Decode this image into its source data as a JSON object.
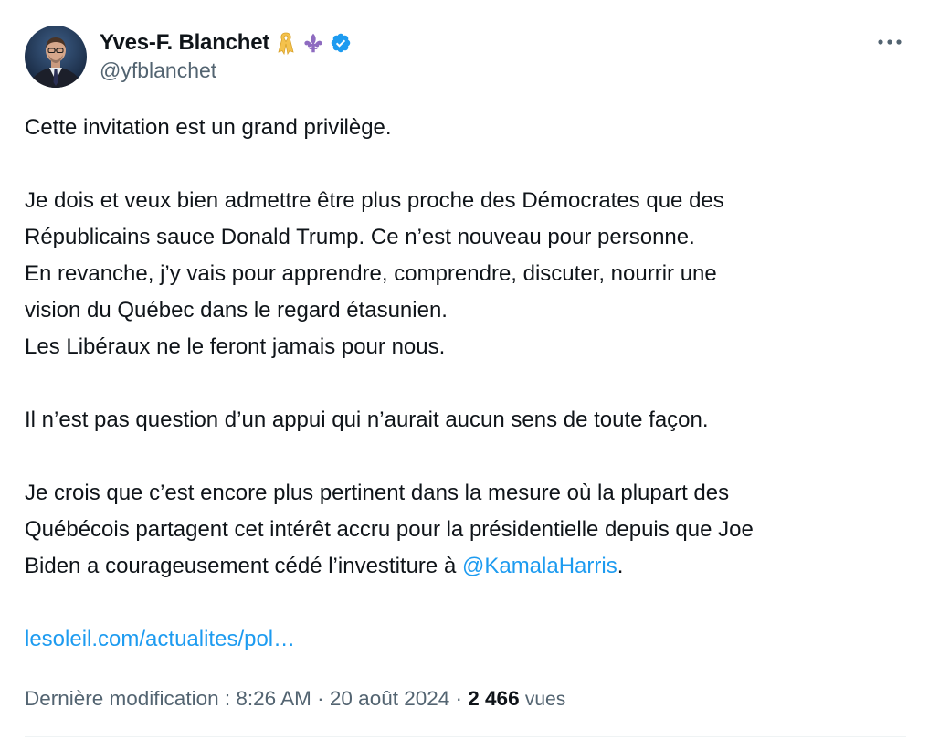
{
  "author": {
    "display_name": "Yves-F. Blanchet",
    "handle": "@yfblanchet",
    "badges": [
      "yellow-ribbon-icon",
      "fleur-de-lis-icon",
      "verified-badge-icon"
    ]
  },
  "colors": {
    "text": "#0f1419",
    "secondary": "#536471",
    "link": "#1d9bf0",
    "verified": "#1d9bf0"
  },
  "tweet": {
    "line1": "Cette invitation est un grand privilège.",
    "line2": "Je dois et veux bien admettre être plus proche des Démocrates que des",
    "line3": "Républicains sauce Donald Trump. Ce n’est nouveau pour personne.",
    "line4": "En revanche, j’y vais pour apprendre, comprendre, discuter, nourrir une",
    "line5": "vision du Québec dans le regard étasunien.",
    "line6": "Les Libéraux ne le feront jamais pour nous.",
    "line7": "Il n’est pas question d’un appui qui n’aurait aucun sens de toute façon.",
    "line8": "Je crois que c’est encore plus pertinent dans la mesure où la plupart des",
    "line9": "Québécois partagent cet intérêt accru pour la présidentielle depuis que Joe",
    "line10_prefix": "Biden a courageusement cédé l’investiture à ",
    "mention": "@KamalaHarris",
    "line10_suffix": ".",
    "link": "lesoleil.com/actualites/pol…"
  },
  "meta": {
    "modified_label": "Dernière modification : 8:26 AM · 20 août 2024 · ",
    "views_count": "2 466",
    "views_label": "vues"
  }
}
